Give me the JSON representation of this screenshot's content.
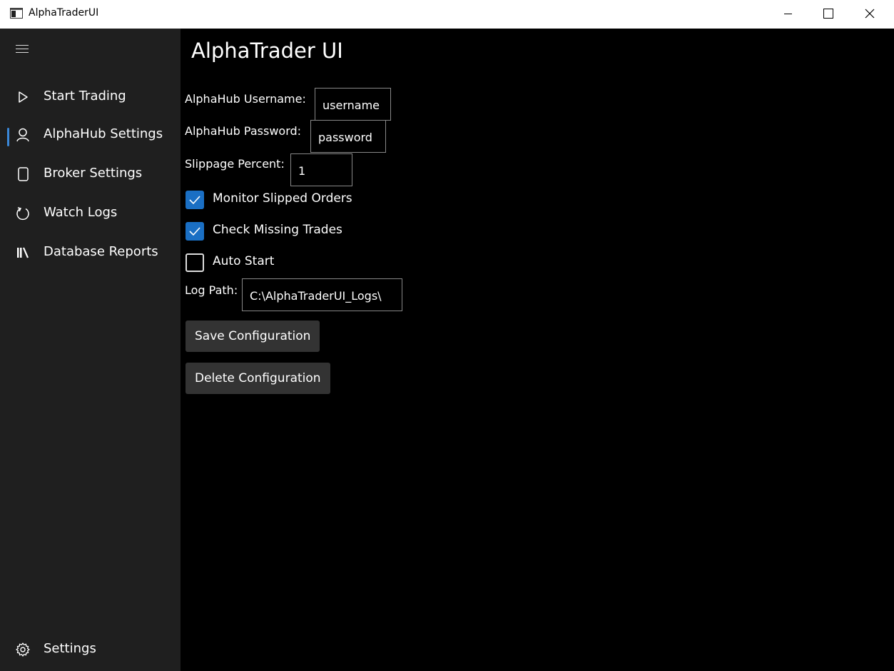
{
  "window": {
    "title": "AlphaTraderUI"
  },
  "sidebar": {
    "items": [
      {
        "label": "Start Trading",
        "icon": "play-icon"
      },
      {
        "label": "AlphaHub Settings",
        "icon": "person-icon",
        "selected": true
      },
      {
        "label": "Broker Settings",
        "icon": "device-icon"
      },
      {
        "label": "Watch Logs",
        "icon": "refresh-icon"
      },
      {
        "label": "Database Reports",
        "icon": "library-icon"
      }
    ],
    "settings_label": "Settings"
  },
  "main": {
    "title": "AlphaTrader UI",
    "username": {
      "label": "AlphaHub Username:",
      "value": "username"
    },
    "password": {
      "label": "AlphaHub Password:",
      "value": "password"
    },
    "slippage": {
      "label": "Slippage Percent:",
      "value": "1"
    },
    "checkboxes": [
      {
        "label": "Monitor Slipped Orders",
        "checked": true
      },
      {
        "label": "Check Missing Trades",
        "checked": true
      },
      {
        "label": "Auto Start",
        "checked": false
      }
    ],
    "log_path": {
      "label": "Log Path:",
      "value": "C:\\AlphaTraderUI_Logs\\"
    },
    "save_button": "Save Configuration",
    "delete_button": "Delete Configuration"
  },
  "colors": {
    "accent": "#1a6fc4",
    "selection_indicator": "#3a87d8",
    "sidebar_bg": "#1f1f1f",
    "main_bg": "#000000",
    "button_bg": "#333333"
  }
}
